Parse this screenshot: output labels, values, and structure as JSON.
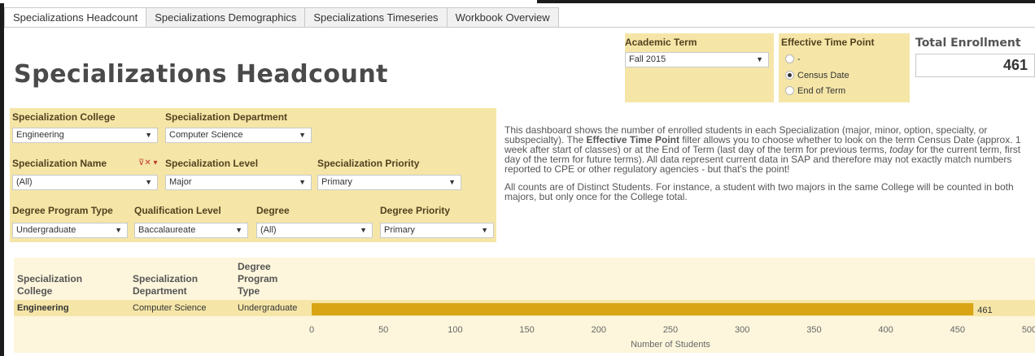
{
  "tabs": [
    "Specializations Headcount",
    "Specializations Demographics",
    "Specializations Timeseries",
    "Workbook Overview"
  ],
  "active_tab": 0,
  "page_title": "Specializations Headcount",
  "academic_term": {
    "label": "Academic Term",
    "value": "Fall 2015"
  },
  "effective_time_point": {
    "label": "Effective Time Point",
    "options": [
      "-",
      "Census Date",
      "End of Term"
    ],
    "selected": "Census Date"
  },
  "total_enrollment": {
    "label": "Total Enrollment",
    "value": "461"
  },
  "filters": {
    "college": {
      "label": "Specialization College",
      "value": "Engineering"
    },
    "department": {
      "label": "Specialization Department",
      "value": "Computer Science"
    },
    "name": {
      "label": "Specialization Name",
      "value": "(All)"
    },
    "level": {
      "label": "Specialization Level",
      "value": "Major"
    },
    "priority": {
      "label": "Specialization Priority",
      "value": "Primary"
    },
    "program_type": {
      "label": "Degree Program Type",
      "value": "Undergraduate"
    },
    "qualification": {
      "label": "Qualification Level",
      "value": "Baccalaureate"
    },
    "degree": {
      "label": "Degree",
      "value": "(All)"
    },
    "degree_priority": {
      "label": "Degree Priority",
      "value": "Primary"
    }
  },
  "description": {
    "p1_a": "This dashboard shows the number of enrolled students in each Specialization (major, minor, option, specialty, or subspecialty). The ",
    "p1_b": "Effective Time Point",
    "p1_c": " filter allows you to choose whether to look on the term Census Date (approx. 1 week after start of classes) or at the End of Term (last day of the term for previous terms, ",
    "p1_d": "today",
    "p1_e": " for the current term, first day of the term for future terms). All data represent current data in SAP and therefore may not exactly match numbers reported to CPE or other regulatory agencies - but that's the point!",
    "p2": "All counts are of Distinct Students. For instance, a student with two majors in the same College will be counted in both majors, but only once for the College total."
  },
  "table_headers": {
    "college": "Specialization College",
    "department": "Specialization Department",
    "program_type": "Degree Program Type"
  },
  "chart_data": {
    "type": "bar",
    "orientation": "horizontal",
    "rows": [
      {
        "college": "Engineering",
        "department": "Computer Science",
        "program_type": "Undergraduate",
        "value": 461
      }
    ],
    "xlabel": "Number of Students",
    "xlim": [
      0,
      500
    ],
    "xticks": [
      0,
      50,
      100,
      150,
      200,
      250,
      300,
      350,
      400,
      450,
      500
    ],
    "bar_color": "#d9a514",
    "data_label": "461"
  },
  "colors": {
    "filter_bg": "#f5e6a8",
    "chart_bg": "#fdf6dc",
    "bar": "#d9a514"
  }
}
